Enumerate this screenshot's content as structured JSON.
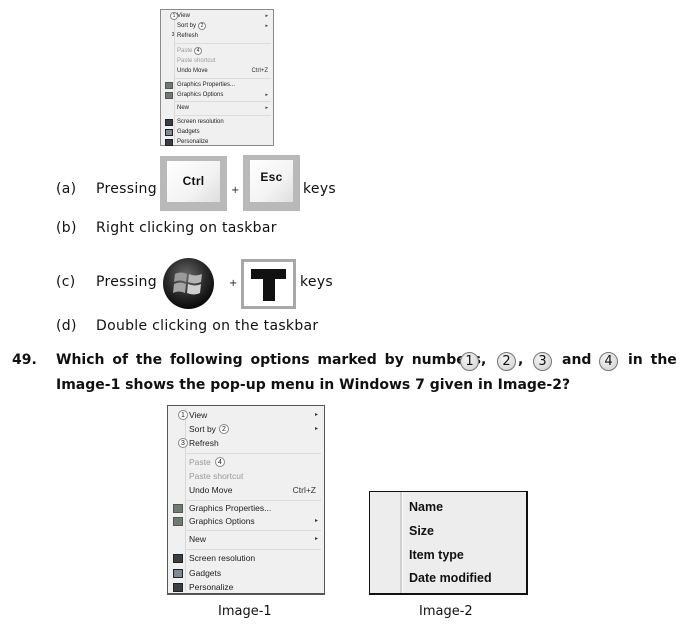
{
  "context_menu_small": {
    "items": [
      {
        "label": "View",
        "marker": "1",
        "submenu": true,
        "disabled": false
      },
      {
        "label": "Sort by",
        "marker": "2",
        "submenu": true,
        "disabled": false
      },
      {
        "label": "Refresh",
        "marker": "3",
        "submenu": false,
        "disabled": false
      },
      {
        "label": "Paste",
        "marker": "4",
        "submenu": false,
        "disabled": true
      },
      {
        "label": "Paste shortcut",
        "submenu": false,
        "disabled": true
      },
      {
        "label": "Undo Move",
        "shortcut": "Ctrl+Z",
        "submenu": false,
        "disabled": false
      },
      {
        "label": "Graphics Properties...",
        "icon": "graphics-icon",
        "submenu": false,
        "disabled": false
      },
      {
        "label": "Graphics Options",
        "icon": "graphics-icon",
        "submenu": true,
        "disabled": false
      },
      {
        "label": "New",
        "submenu": true,
        "disabled": false
      },
      {
        "label": "Screen resolution",
        "icon": "monitor-icon",
        "submenu": false,
        "disabled": false
      },
      {
        "label": "Gadgets",
        "icon": "gadgets-icon",
        "submenu": false,
        "disabled": false
      },
      {
        "label": "Personalize",
        "icon": "personalize-icon",
        "submenu": false,
        "disabled": false
      }
    ],
    "arrow_glyph": "▸"
  },
  "options_48": {
    "a": {
      "letter": "(a)",
      "prefix": "Pressing",
      "key1": "Ctrl",
      "plus": "+",
      "key2": "Esc",
      "suffix": "keys"
    },
    "b": {
      "letter": "(b)",
      "text": "Right clicking on taskbar"
    },
    "c": {
      "letter": "(c)",
      "prefix": "Pressing",
      "key1_icon": "windows-logo-key",
      "plus": "+",
      "key2": "T",
      "suffix": "keys"
    },
    "d": {
      "letter": "(d)",
      "text": "Double clicking on the taskbar"
    }
  },
  "question_49": {
    "number": "49.",
    "line1_before": "Which of the following options marked by numbers",
    "markers": [
      "1",
      "2",
      "3",
      "4"
    ],
    "comma": ",",
    "and": "and",
    "line1_after": "in the",
    "line2": "Image-1 shows the pop-up menu in Windows 7 given in Image-2?"
  },
  "image1": {
    "caption": "Image-1",
    "items": [
      {
        "label": "View",
        "marker": "1",
        "submenu": true,
        "disabled": false
      },
      {
        "label": "Sort by",
        "marker": "2",
        "submenu": true,
        "disabled": false
      },
      {
        "label": "Refresh",
        "marker": "3",
        "submenu": false,
        "disabled": false
      },
      {
        "label": "Paste",
        "marker": "4",
        "submenu": false,
        "disabled": true
      },
      {
        "label": "Paste shortcut",
        "submenu": false,
        "disabled": true
      },
      {
        "label": "Undo Move",
        "shortcut": "Ctrl+Z",
        "submenu": false,
        "disabled": false
      },
      {
        "label": "Graphics Properties...",
        "icon": "graphics-icon",
        "submenu": false,
        "disabled": false
      },
      {
        "label": "Graphics Options",
        "icon": "graphics-icon",
        "submenu": true,
        "disabled": false
      },
      {
        "label": "New",
        "submenu": true,
        "disabled": false
      },
      {
        "label": "Screen resolution",
        "icon": "monitor-icon",
        "submenu": false,
        "disabled": false
      },
      {
        "label": "Gadgets",
        "icon": "gadgets-icon",
        "submenu": false,
        "disabled": false
      },
      {
        "label": "Personalize",
        "icon": "personalize-icon",
        "submenu": false,
        "disabled": false
      }
    ]
  },
  "image2": {
    "caption": "Image-2",
    "items": [
      "Name",
      "Size",
      "Item type",
      "Date modified"
    ]
  }
}
